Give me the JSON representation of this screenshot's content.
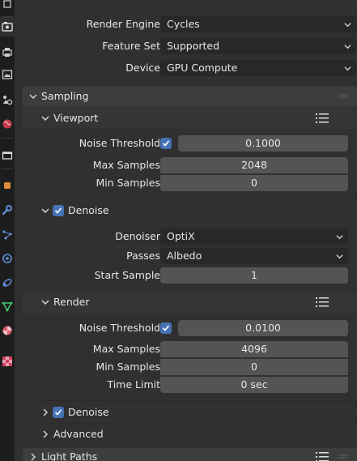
{
  "top": {
    "render_engine": {
      "label": "Render Engine",
      "value": "Cycles"
    },
    "feature_set": {
      "label": "Feature Set",
      "value": "Supported"
    },
    "device": {
      "label": "Device",
      "value": "GPU Compute"
    }
  },
  "sampling": {
    "title": "Sampling",
    "viewport": {
      "title": "Viewport",
      "noise_threshold": {
        "label": "Noise Threshold",
        "enabled": true,
        "value": "0.1000"
      },
      "max_samples": {
        "label": "Max Samples",
        "value": "2048"
      },
      "min_samples": {
        "label": "Min Samples",
        "value": "0"
      },
      "denoise": {
        "title": "Denoise",
        "enabled": true,
        "denoiser": {
          "label": "Denoiser",
          "value": "OptiX"
        },
        "passes": {
          "label": "Passes",
          "value": "Albedo"
        },
        "start_sample": {
          "label": "Start Sample",
          "value": "1"
        }
      }
    },
    "render": {
      "title": "Render",
      "noise_threshold": {
        "label": "Noise Threshold",
        "enabled": true,
        "value": "0.0100"
      },
      "max_samples": {
        "label": "Max Samples",
        "value": "4096"
      },
      "min_samples": {
        "label": "Min Samples",
        "value": "0"
      },
      "time_limit": {
        "label": "Time Limit",
        "value": "0 sec"
      },
      "denoise": {
        "title": "Denoise",
        "enabled": true
      }
    },
    "advanced": {
      "title": "Advanced"
    }
  },
  "light_paths": {
    "title": "Light Paths"
  },
  "tabs": [
    {
      "name": "tool-tab",
      "icon": "tool-icon",
      "color": "#bbbbbb"
    },
    {
      "name": "render-tab",
      "icon": "camera-back-icon",
      "color": "#dddddd",
      "active": true
    },
    {
      "name": "output-tab",
      "icon": "printer-icon",
      "color": "#cccccc"
    },
    {
      "name": "view-layer-tab",
      "icon": "image-icon",
      "color": "#cccccc"
    },
    {
      "name": "scene-tab",
      "icon": "scene-icon",
      "color": "#cccccc"
    },
    {
      "name": "world-tab",
      "icon": "world-icon",
      "color": "#e0455a"
    },
    {
      "name": "collection-tab",
      "icon": "collection-icon",
      "color": "#dddddd"
    },
    {
      "name": "object-tab",
      "icon": "object-icon",
      "color": "#e08b3a"
    },
    {
      "name": "modifier-tab",
      "icon": "wrench-icon",
      "color": "#5f8fd9"
    },
    {
      "name": "particles-tab",
      "icon": "particles-icon",
      "color": "#5f8fd9"
    },
    {
      "name": "physics-tab",
      "icon": "physics-icon",
      "color": "#5f8fd9"
    },
    {
      "name": "constraints-tab",
      "icon": "constraints-icon",
      "color": "#5f8fd9"
    },
    {
      "name": "data-tab",
      "icon": "mesh-data-icon",
      "color": "#3fcf6f"
    },
    {
      "name": "material-tab",
      "icon": "material-icon",
      "color": "#e05a6a"
    },
    {
      "name": "texture-tab",
      "icon": "texture-icon",
      "color": "#d04060"
    }
  ],
  "colors": {
    "accent": "#4772b3",
    "panel_header": "#3d3d3d",
    "field_numeric": "#545454",
    "field_dropdown": "#282828",
    "background": "#303030",
    "tabstrip": "#1d1d1d"
  }
}
